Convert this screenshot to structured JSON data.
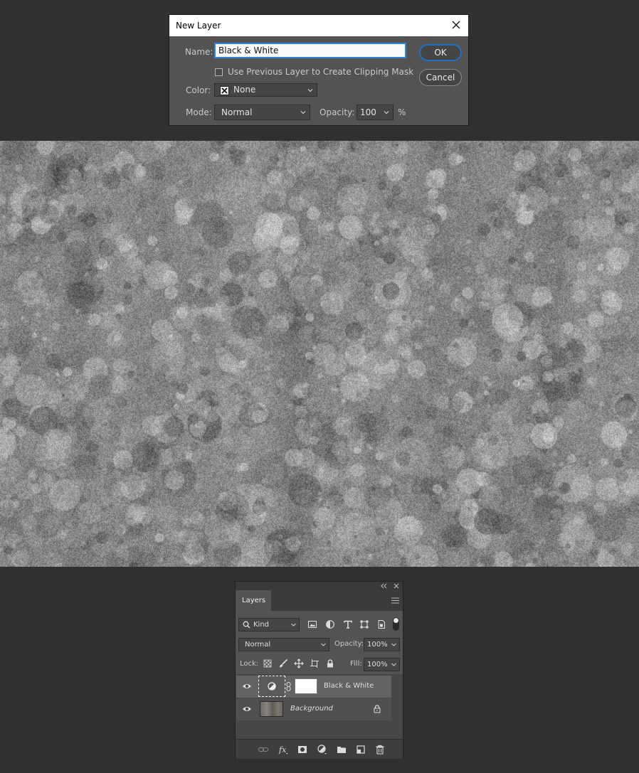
{
  "dialog": {
    "title": "New Layer",
    "name_label": "Name:",
    "name_value": "Black & White",
    "clipping_label": "Use Previous Layer to Create Clipping Mask",
    "clipping_checked": false,
    "color_label": "Color:",
    "color_value": "None",
    "mode_label": "Mode:",
    "mode_value": "Normal",
    "opacity_label": "Opacity:",
    "opacity_value": "100",
    "opacity_unit": "%",
    "ok_label": "OK",
    "cancel_label": "Cancel"
  },
  "layers_panel": {
    "tab_label": "Layers",
    "filter_value": "Kind",
    "blend_mode": "Normal",
    "opacity_label": "Opacity:",
    "opacity_value": "100%",
    "lock_label": "Lock:",
    "fill_label": "Fill:",
    "fill_value": "100%",
    "layers": [
      {
        "name": "Black & White",
        "selected": true,
        "icon": "adjustment-icon"
      },
      {
        "name": "Background",
        "italic": true,
        "locked": true,
        "icon": "lock-icon"
      }
    ]
  },
  "colors": {
    "app_bg": "#303030",
    "panel_bg": "#535353",
    "accent": "#1e73c6"
  }
}
